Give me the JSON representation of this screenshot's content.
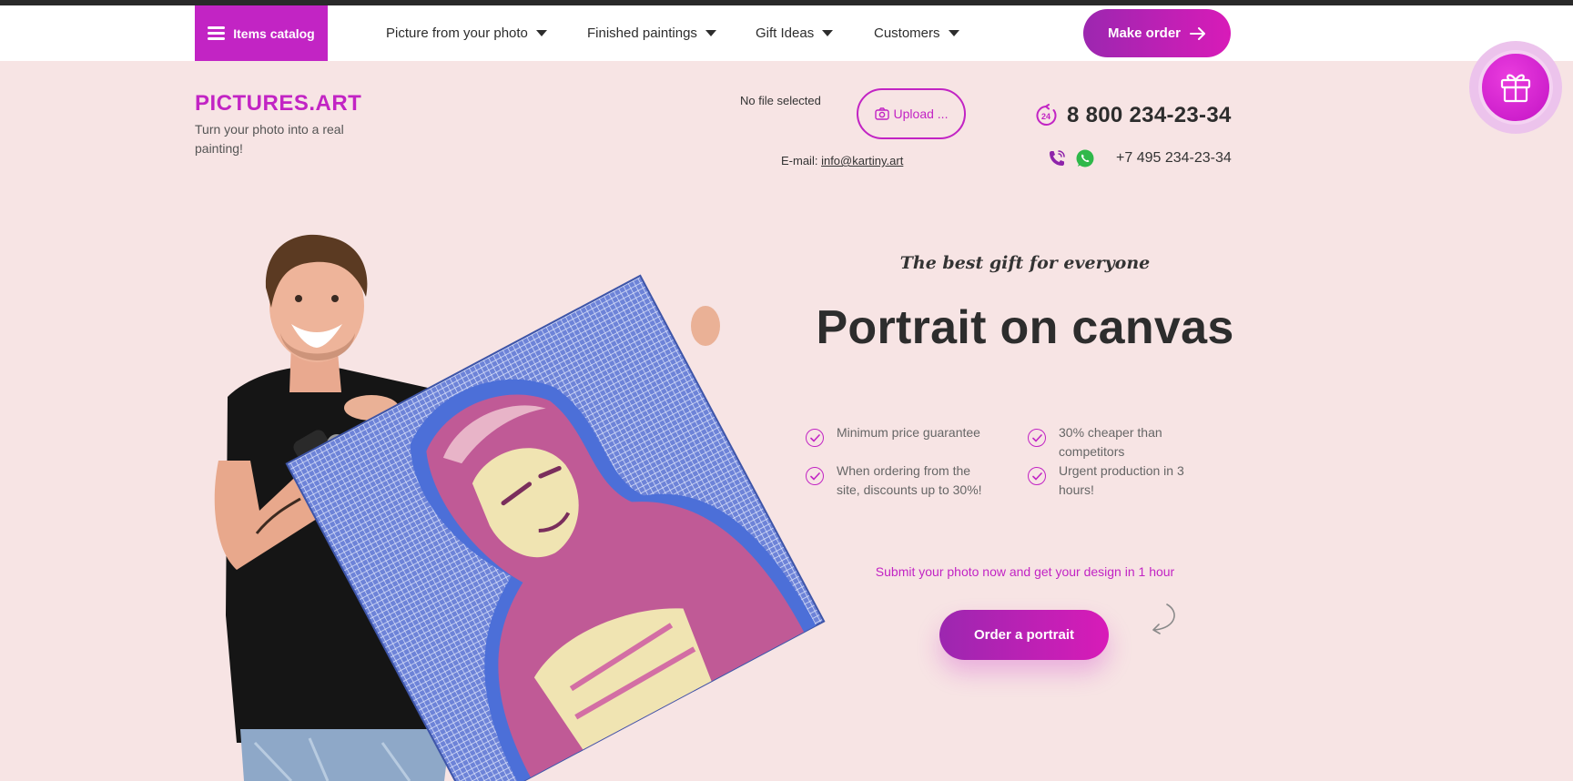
{
  "colors": {
    "accent": "#c224c4",
    "accent_dark": "#9c27b0",
    "background": "#f7e4e4",
    "text": "#2d2d2d"
  },
  "nav": {
    "catalog_label": "Items catalog",
    "items": [
      {
        "label": "Picture from your photo"
      },
      {
        "label": "Finished paintings"
      },
      {
        "label": "Gift Ideas"
      },
      {
        "label": "Customers"
      }
    ],
    "make_order_label": "Make order"
  },
  "header": {
    "brand": "PICTURES.ART",
    "tagline": "Turn your photo into a real painting!",
    "file_status": "No file selected",
    "upload_label": "Upload ...",
    "email_label": "E-mail:",
    "email": "info@kartiny.art",
    "phone_main": "8 800 234-23-34",
    "phone_secondary": "+7 495 234-23-34",
    "hours_badge": "24"
  },
  "hero": {
    "subtitle": "The best gift for everyone",
    "title": "Portrait on canvas",
    "features": [
      {
        "text": "Minimum price guarantee"
      },
      {
        "text": "30% cheaper than competitors"
      },
      {
        "text": "When ordering from the site, discounts up to 30%!"
      },
      {
        "text": "Urgent production in 3 hours!"
      }
    ],
    "promo": "Submit your photo now and get your design in 1 hour",
    "order_label": "Order a portrait"
  },
  "icons": {
    "menu": "menu-icon",
    "caret": "chevron-down-icon",
    "arrow": "arrow-right-icon",
    "camera": "camera-icon",
    "clock": "clock-24-icon",
    "phone": "phone-icon",
    "whatsapp": "whatsapp-icon",
    "gift": "gift-icon",
    "check": "check-circle-icon"
  }
}
